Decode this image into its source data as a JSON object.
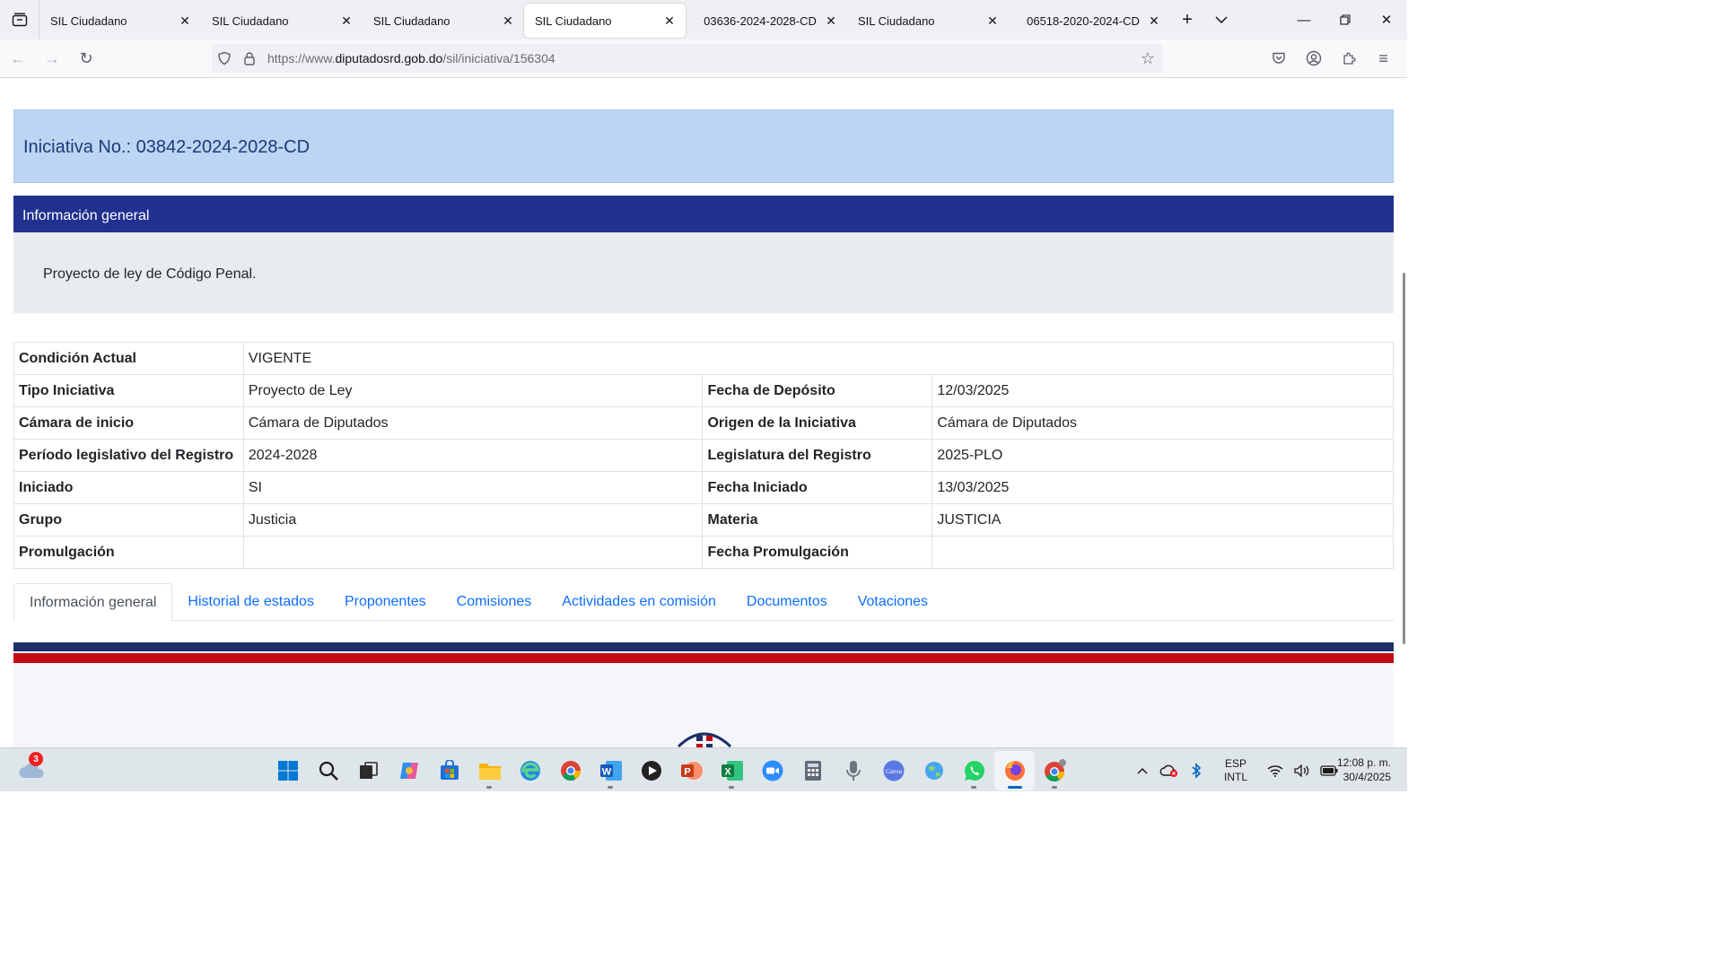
{
  "browser": {
    "tabs": [
      {
        "title": "SIL Ciudadano",
        "active": false
      },
      {
        "title": "SIL Ciudadano",
        "active": false
      },
      {
        "title": "SIL Ciudadano",
        "active": false
      },
      {
        "title": "SIL Ciudadano",
        "active": true
      },
      {
        "title": "03636-2024-2028-CD",
        "active": false
      },
      {
        "title": "SIL Ciudadano",
        "active": false
      },
      {
        "title": "06518-2020-2024-CD",
        "active": false
      }
    ],
    "url": {
      "scheme": "https://www.",
      "host": "diputadosrd.gob.do",
      "path": "/sil/iniciativa/156304"
    }
  },
  "page": {
    "initiative_title": "Iniciativa No.: 03842-2024-2028-CD",
    "section_title": "Información general",
    "summary": "Proyecto de ley de Código Penal.",
    "details": [
      {
        "label1": "Condición Actual",
        "value1": "VIGENTE",
        "label2": "",
        "value2": ""
      },
      {
        "label1": "Tipo Iniciativa",
        "value1": "Proyecto de Ley",
        "label2": "Fecha de Depósito",
        "value2": "12/03/2025"
      },
      {
        "label1": "Cámara de inicio",
        "value1": "Cámara de Diputados",
        "label2": "Origen de la Iniciativa",
        "value2": "Cámara de Diputados"
      },
      {
        "label1": "Período legislativo del Registro",
        "value1": "2024-2028",
        "label2": "Legislatura del Registro",
        "value2": "2025-PLO"
      },
      {
        "label1": "Iniciado",
        "value1": "SI",
        "label2": "Fecha Iniciado",
        "value2": "13/03/2025"
      },
      {
        "label1": "Grupo",
        "value1": "Justicia",
        "label2": "Materia",
        "value2": "JUSTICIA"
      },
      {
        "label1": "Promulgación",
        "value1": "",
        "label2": "Fecha Promulgación",
        "value2": ""
      }
    ],
    "tabs": [
      {
        "label": "Información general",
        "active": true
      },
      {
        "label": "Historial de estados",
        "active": false
      },
      {
        "label": "Proponentes",
        "active": false
      },
      {
        "label": "Comisiones",
        "active": false
      },
      {
        "label": "Actividades en comisión",
        "active": false
      },
      {
        "label": "Documentos",
        "active": false
      },
      {
        "label": "Votaciones",
        "active": false
      }
    ]
  },
  "taskbar": {
    "weather_badge": "3",
    "language": {
      "line1": "ESP",
      "line2": "INTL"
    },
    "clock": {
      "time": "12:08 p. m.",
      "date": "30/4/2025"
    }
  }
}
